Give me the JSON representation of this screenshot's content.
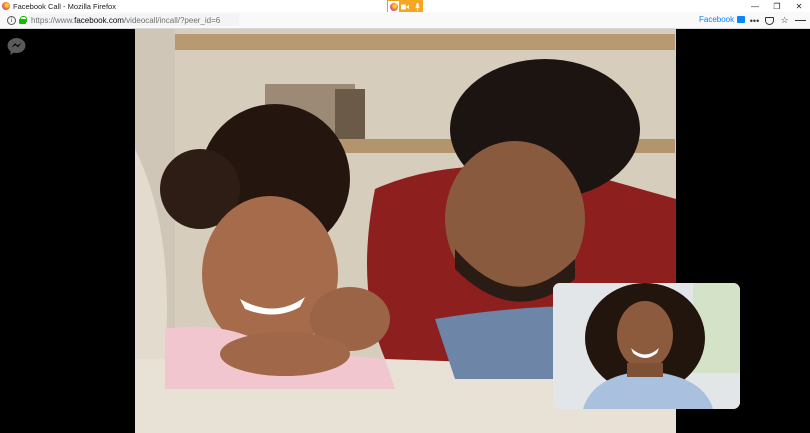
{
  "window": {
    "title": "Facebook Call - Mozilla Firefox",
    "controls": {
      "minimize": "—",
      "restore": "❐",
      "close": "✕"
    }
  },
  "sharing_indicator": {
    "icons": [
      "firefox-icon",
      "camera-icon",
      "microphone-icon"
    ],
    "color": "#f5a623"
  },
  "navbar": {
    "url_prefix": "https://www.",
    "url_host": "facebook.com",
    "url_path": "/videocall/incall/?peer_id=6",
    "container_label": "Facebook",
    "container_color": "#0a84ff",
    "icons": [
      "page-actions-icon",
      "pocket-icon",
      "bookmark-star-icon",
      "menu-icon"
    ]
  },
  "call": {
    "messenger_icon": "messenger-icon",
    "main_video": "remote-participant-video",
    "self_view": "local-participant-video"
  }
}
